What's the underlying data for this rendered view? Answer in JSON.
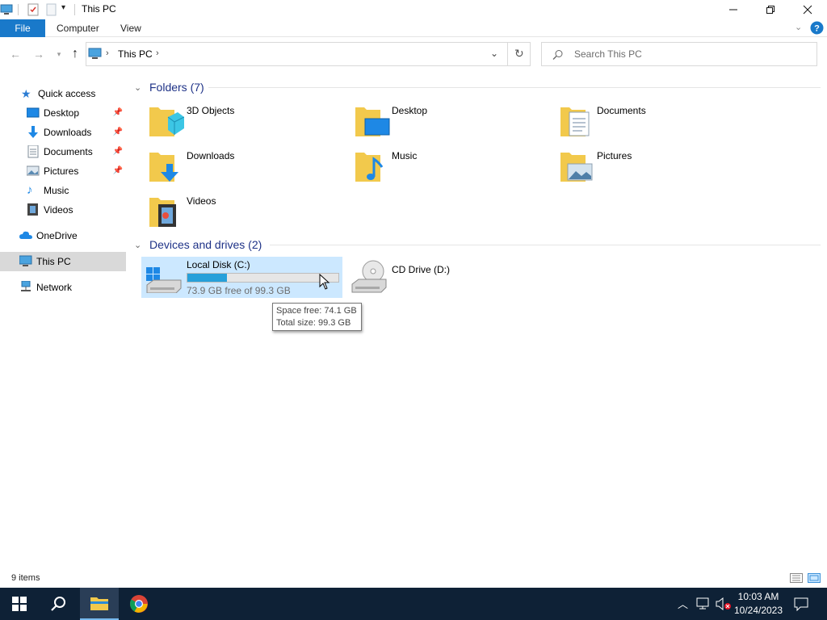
{
  "window": {
    "title": "This PC"
  },
  "ribbon": {
    "tabs": [
      "File",
      "Computer",
      "View"
    ]
  },
  "address": {
    "path": "This PC",
    "search_placeholder": "Search This PC"
  },
  "nav": {
    "quick_access": "Quick access",
    "quick_items": [
      "Desktop",
      "Downloads",
      "Documents",
      "Pictures",
      "Music",
      "Videos"
    ],
    "onedrive": "OneDrive",
    "this_pc": "This PC",
    "network": "Network"
  },
  "folders": {
    "header": "Folders (7)",
    "items": [
      "3D Objects",
      "Desktop",
      "Documents",
      "Downloads",
      "Music",
      "Pictures",
      "Videos"
    ]
  },
  "devices": {
    "header": "Devices and drives (2)",
    "local_disk": {
      "name": "Local Disk (C:)",
      "free_text": "73.9 GB free of 99.3 GB",
      "used_fraction": 0.26
    },
    "cd_drive": {
      "name": "CD Drive (D:)"
    }
  },
  "tooltip": {
    "line1": "Space free: 74.1 GB",
    "line2": "Total size: 99.3 GB"
  },
  "status": {
    "items": "9 items"
  },
  "taskbar": {
    "time": "10:03 AM",
    "date": "10/24/2023"
  },
  "colors": {
    "accent": "#1979ca",
    "selection": "#cce8ff",
    "drive_bar": "#26a0da",
    "taskbar": "#0e2136",
    "group_header": "#1e3287"
  }
}
